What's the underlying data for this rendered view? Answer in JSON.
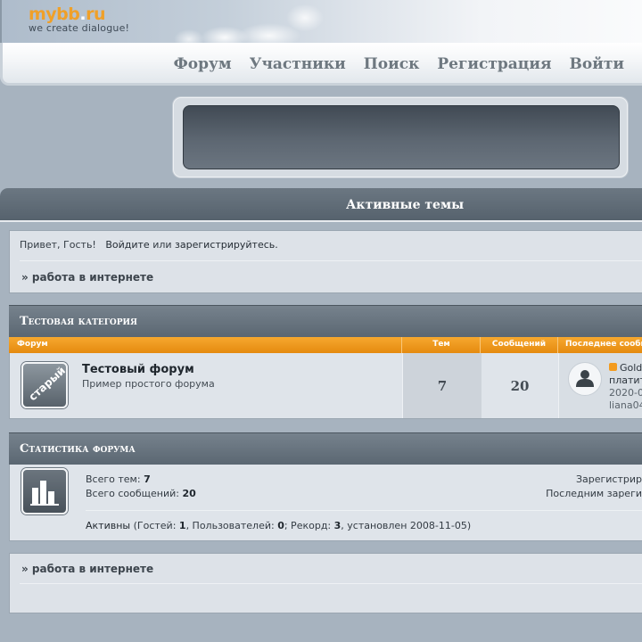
{
  "header": {
    "logo": {
      "name": "mybb",
      "dot": ".",
      "tld": "ru",
      "tagline": "we create dialogue!"
    },
    "nav": [
      "Форум",
      "Участники",
      "Поиск",
      "Регистрация",
      "Войти"
    ]
  },
  "active_topics": {
    "title": "Активные темы"
  },
  "welcome": {
    "greeting": "Привет, Гость!",
    "login": "Войдите",
    "or": "или",
    "register": "зарегистрируйтесь.",
    "crumb": "» работа в интернете"
  },
  "category": {
    "title": "Тестовая категория",
    "columns": [
      "Форум",
      "Тем",
      "Сообщений",
      "Последнее сообщение"
    ],
    "forum": {
      "icon_label": "старый",
      "title": "Тестовый форум",
      "desc": "Пример простого форума",
      "topics": "7",
      "posts": "20",
      "last_post": {
        "topic": "Gold",
        "topic_cont": "платит",
        "date": "2020-0",
        "author": "liana04"
      }
    }
  },
  "stats": {
    "title": "Статистика форума",
    "topics_label": "Всего тем:",
    "topics": "7",
    "posts_label": "Всего сообщений:",
    "posts": "20",
    "registered_label": "Зарегистрир",
    "last_registered_label": "Последним зареги",
    "active_label": "Активны",
    "guests_label": "(Гостей:",
    "guests": "1",
    "users_label": ", Пользователей:",
    "users": "0",
    "record_label": "; Рекорд:",
    "record": "3",
    "record_date_label": ", установлен 2008-11-05)"
  },
  "bottom": {
    "crumb": "» работа в интернете"
  },
  "colors": {
    "orange": "#f39b1f",
    "header_dark": "#5a6671",
    "panel": "#dde2e8"
  },
  "icons": [
    "user-avatar-icon",
    "rss-icon",
    "stats-chart-icon",
    "forum-old-icon"
  ]
}
